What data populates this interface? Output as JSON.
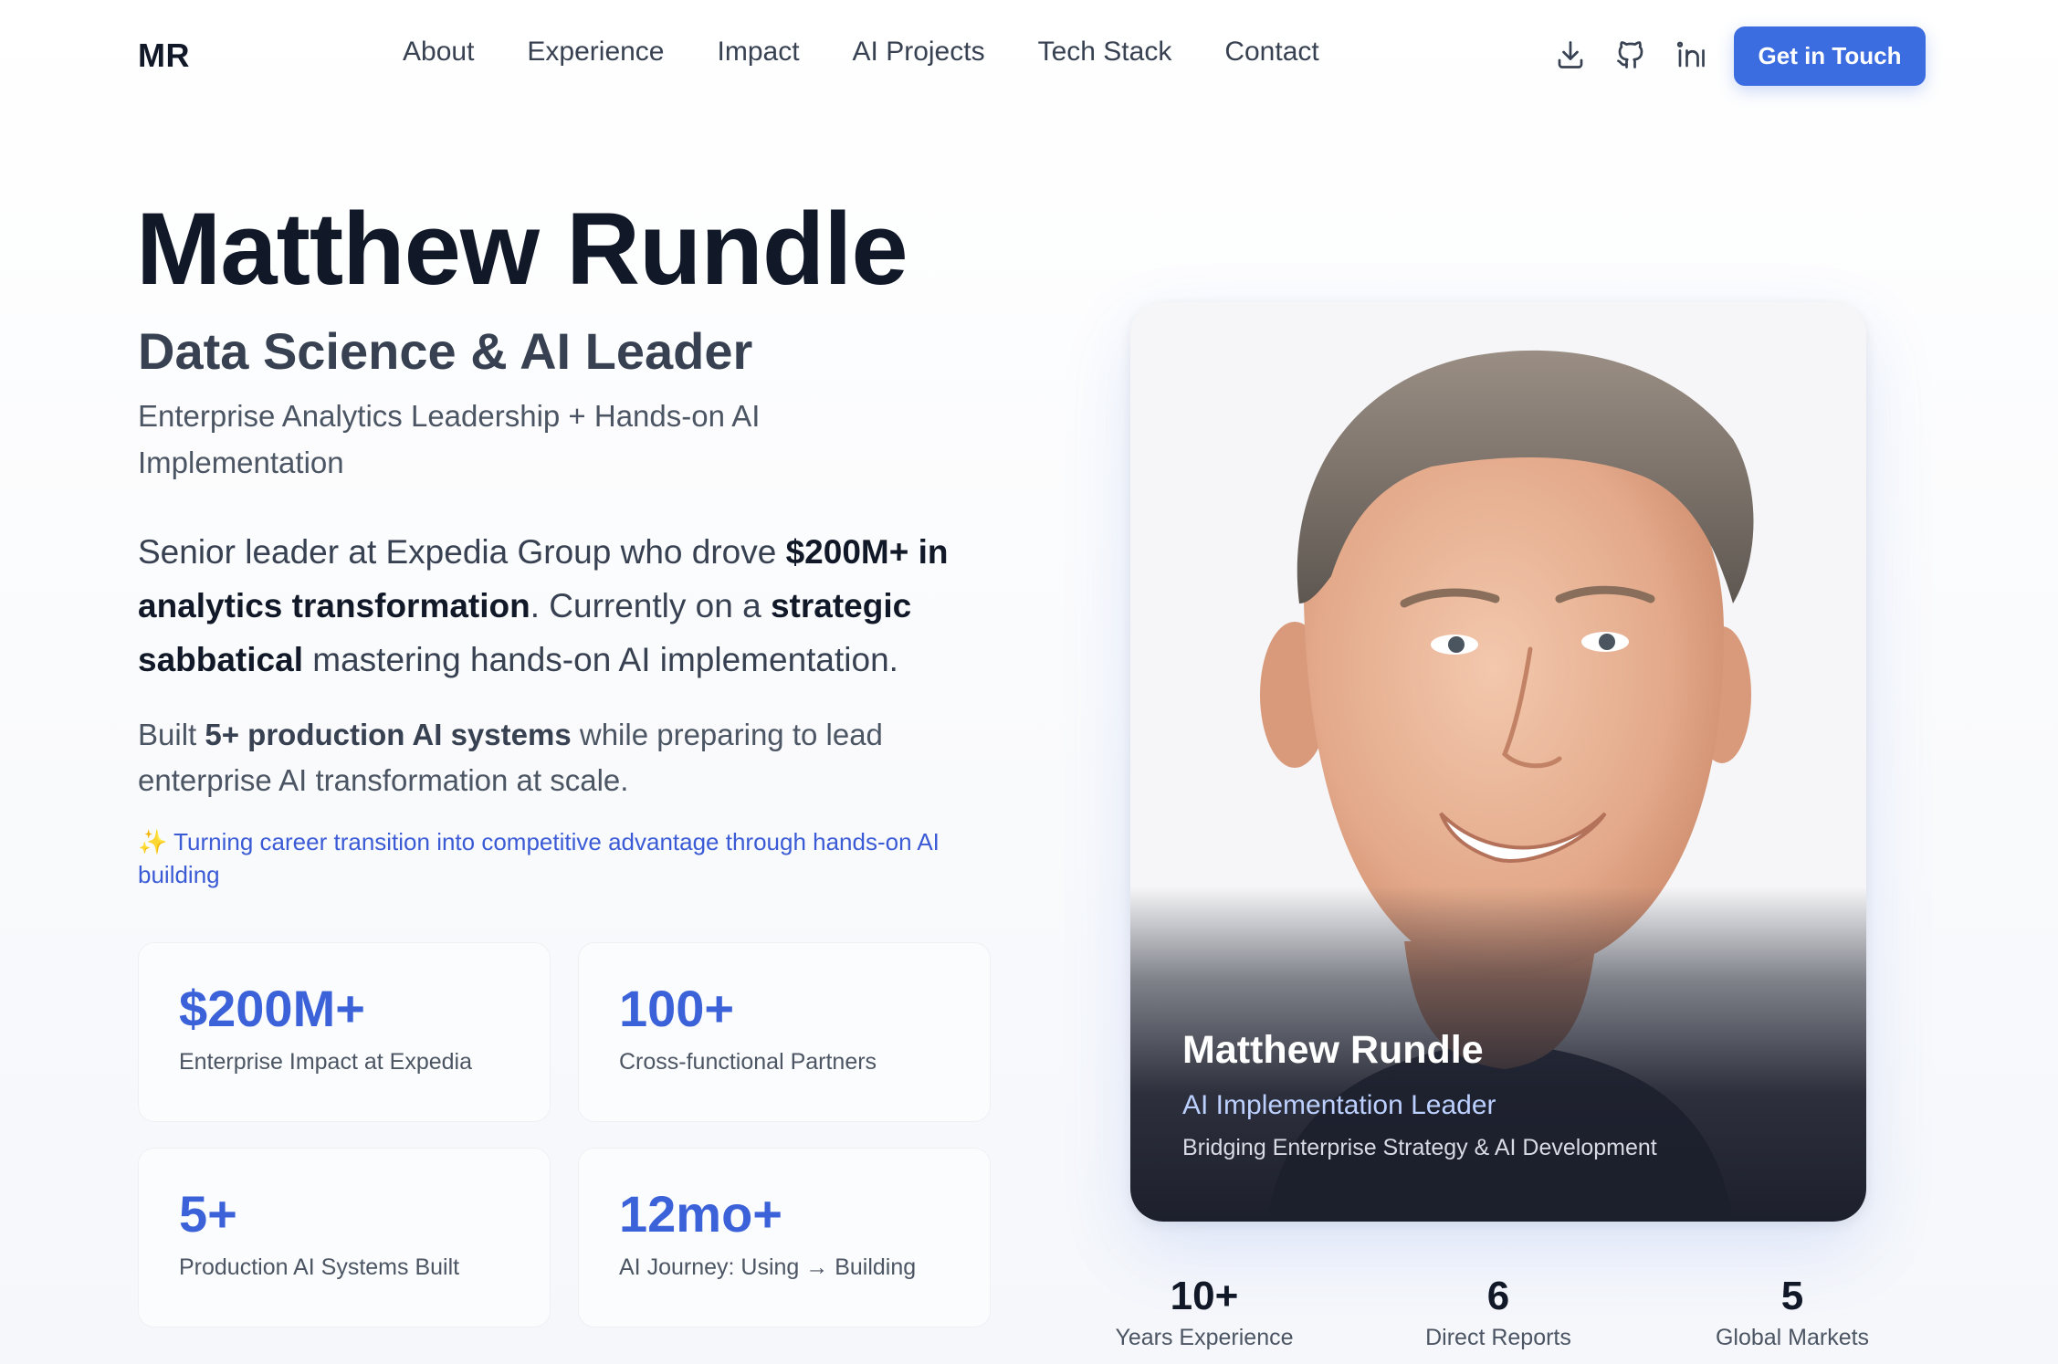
{
  "nav": {
    "logo": "MR",
    "links": [
      "About",
      "Experience",
      "Impact",
      "AI Projects",
      "Tech Stack",
      "Contact"
    ],
    "icons": [
      "download-icon",
      "github-icon",
      "linkedin-icon"
    ],
    "cta_label": "Get in Touch"
  },
  "hero": {
    "name": "Matthew Rundle",
    "title": "Data Science & AI Leader",
    "subtitle": "Enterprise Analytics Leadership + Hands-on AI Implementation",
    "desc": {
      "p1": "Senior leader at Expedia Group who drove ",
      "b1": "$200M+ in analytics transformation",
      "p2": ". Currently on a ",
      "b2": "strategic sabbatical",
      "p3": " mastering hands-on AI implementation."
    },
    "built": {
      "p1": "Built ",
      "b1": "5+ production AI systems",
      "p2": " while preparing to lead enterprise AI transformation at scale."
    },
    "note_icon": "✨",
    "note": "Turning career transition into competitive advantage through hands-on AI building"
  },
  "stats": [
    {
      "value": "$200M+",
      "label": "Enterprise Impact at Expedia"
    },
    {
      "value": "100+",
      "label": "Cross-functional Partners"
    },
    {
      "value": "5+",
      "label": "Production AI Systems Built"
    },
    {
      "value": "12mo+",
      "label": "AI Journey: Using → Building"
    }
  ],
  "profile_card": {
    "name": "Matthew Rundle",
    "role": "AI Implementation Leader",
    "tagline": "Bridging Enterprise Strategy & AI Development"
  },
  "mini_stats": [
    {
      "value": "10+",
      "label": "Years Experience"
    },
    {
      "value": "6",
      "label": "Direct Reports"
    },
    {
      "value": "5",
      "label": "Global Markets"
    }
  ],
  "colors": {
    "accent": "#3b6ce0",
    "stat_value": "#3b62d9",
    "heading": "#111827",
    "body": "#374151",
    "card_dark": "#1c1f2c"
  }
}
